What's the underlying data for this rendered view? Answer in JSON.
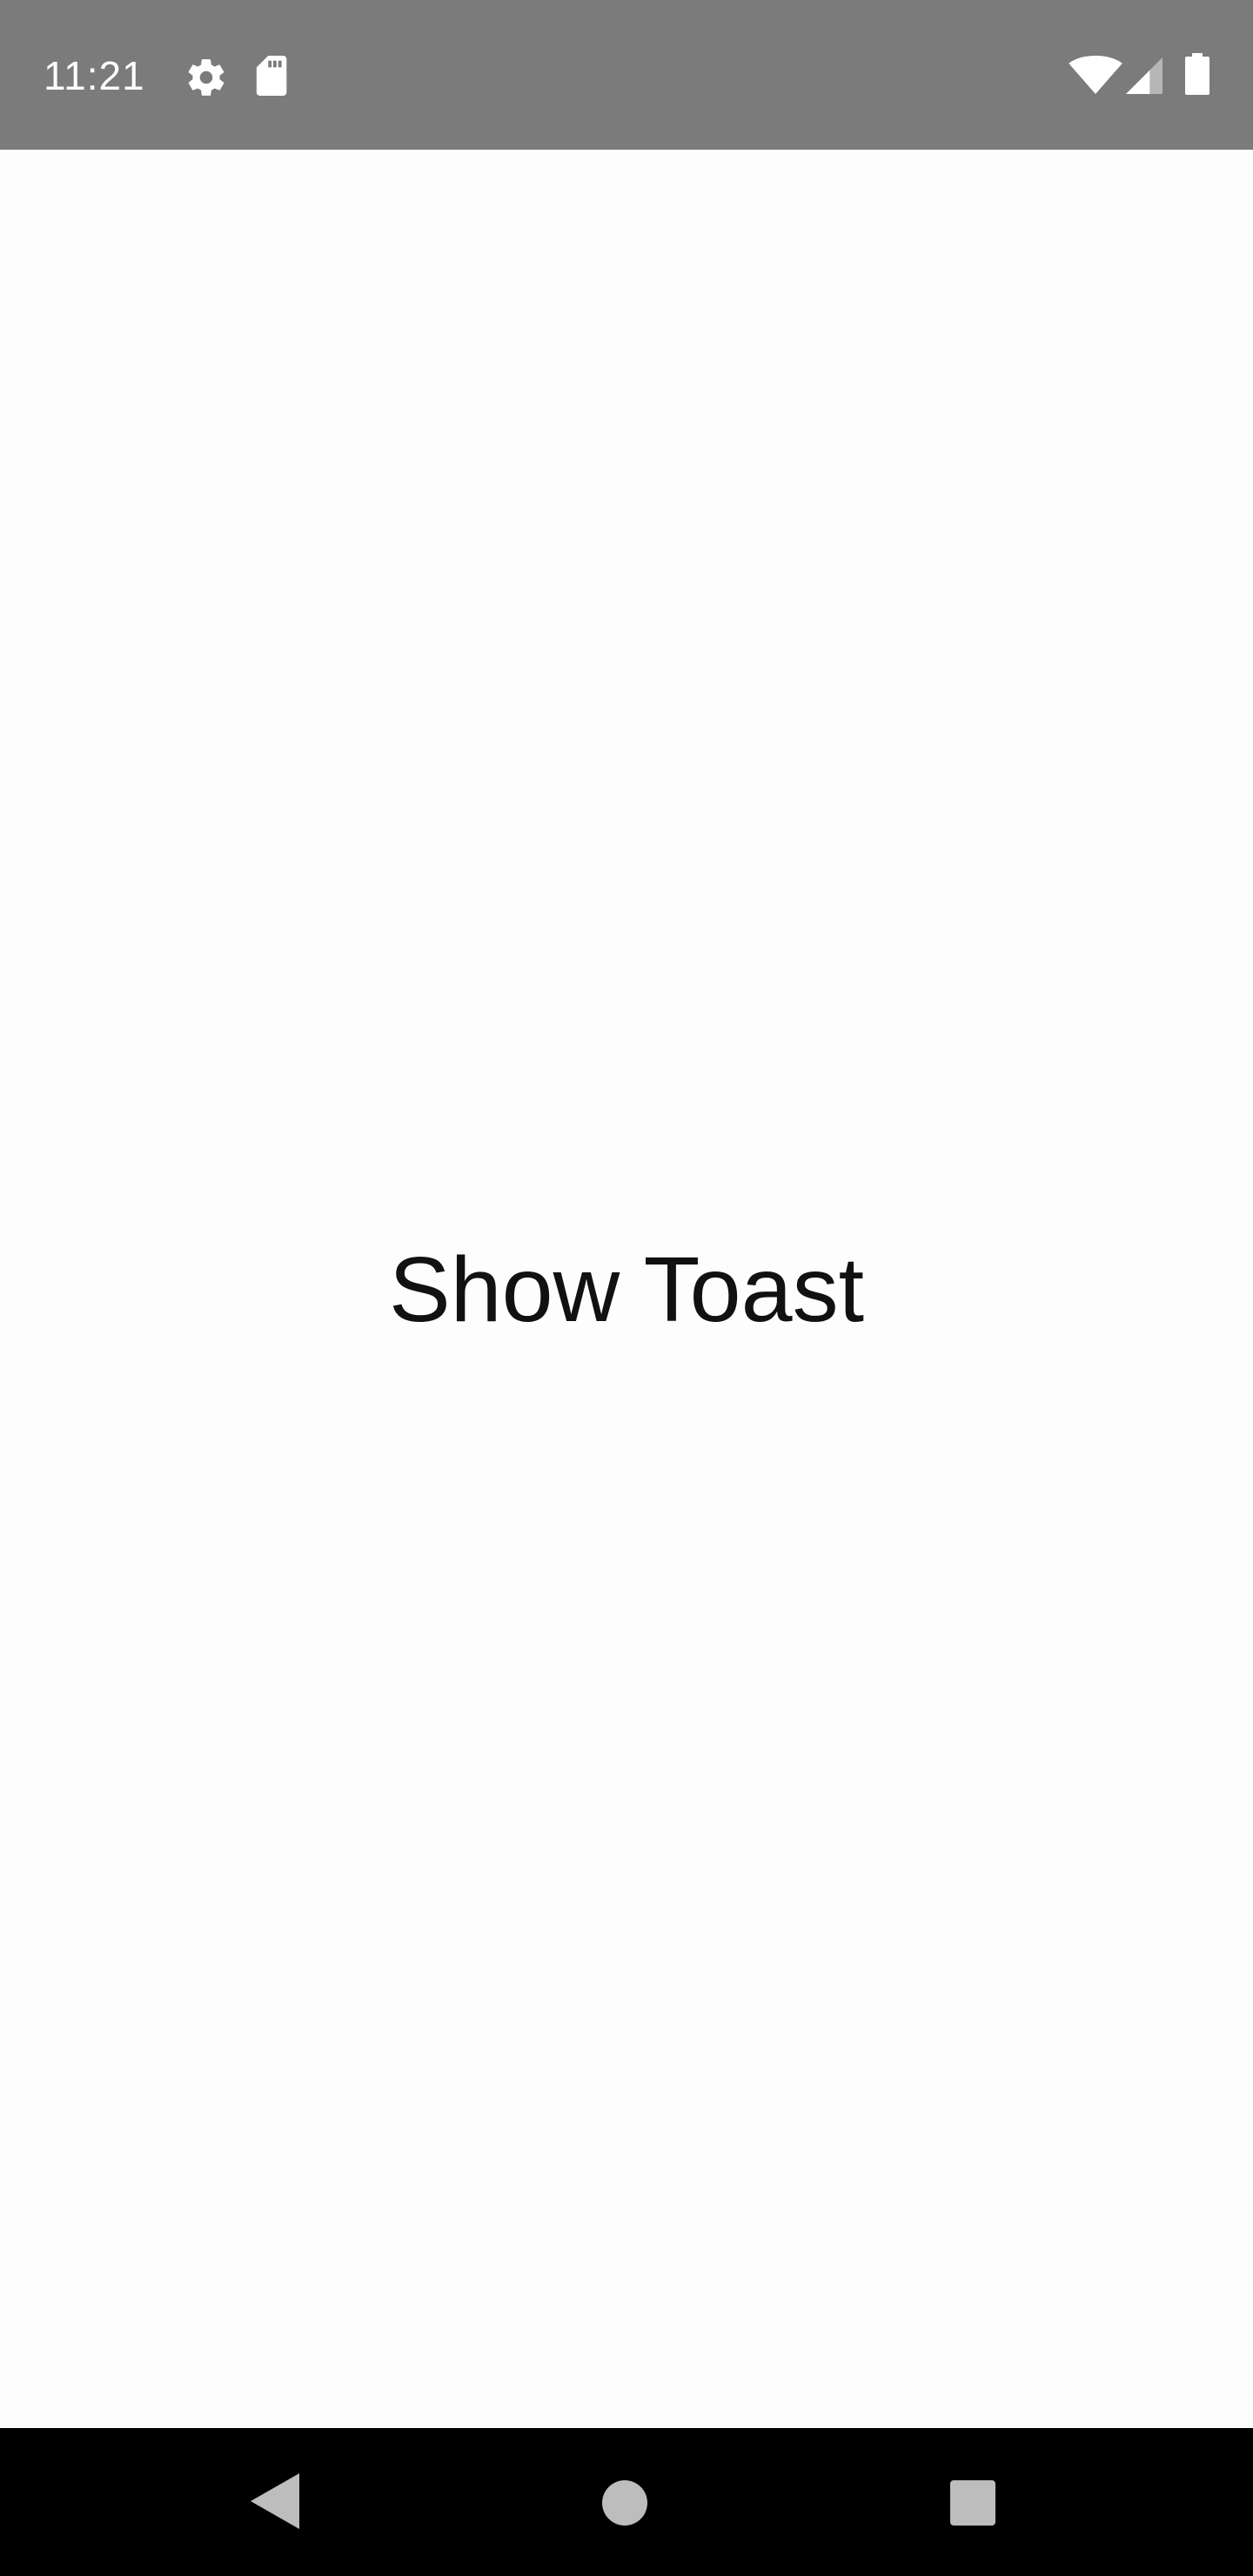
{
  "status_bar": {
    "time": "11:21",
    "background": "#7b7b7b",
    "icons": [
      "gear-icon",
      "sd-card-icon",
      "wifi-icon",
      "cellular-signal-icon",
      "battery-icon"
    ]
  },
  "main": {
    "button_label": "Show Toast",
    "background": "#fdfdfd"
  },
  "nav_bar": {
    "background": "#000000",
    "icons": [
      "back-icon",
      "home-icon",
      "recents-icon"
    ],
    "icon_color": "#bdbdbd"
  }
}
